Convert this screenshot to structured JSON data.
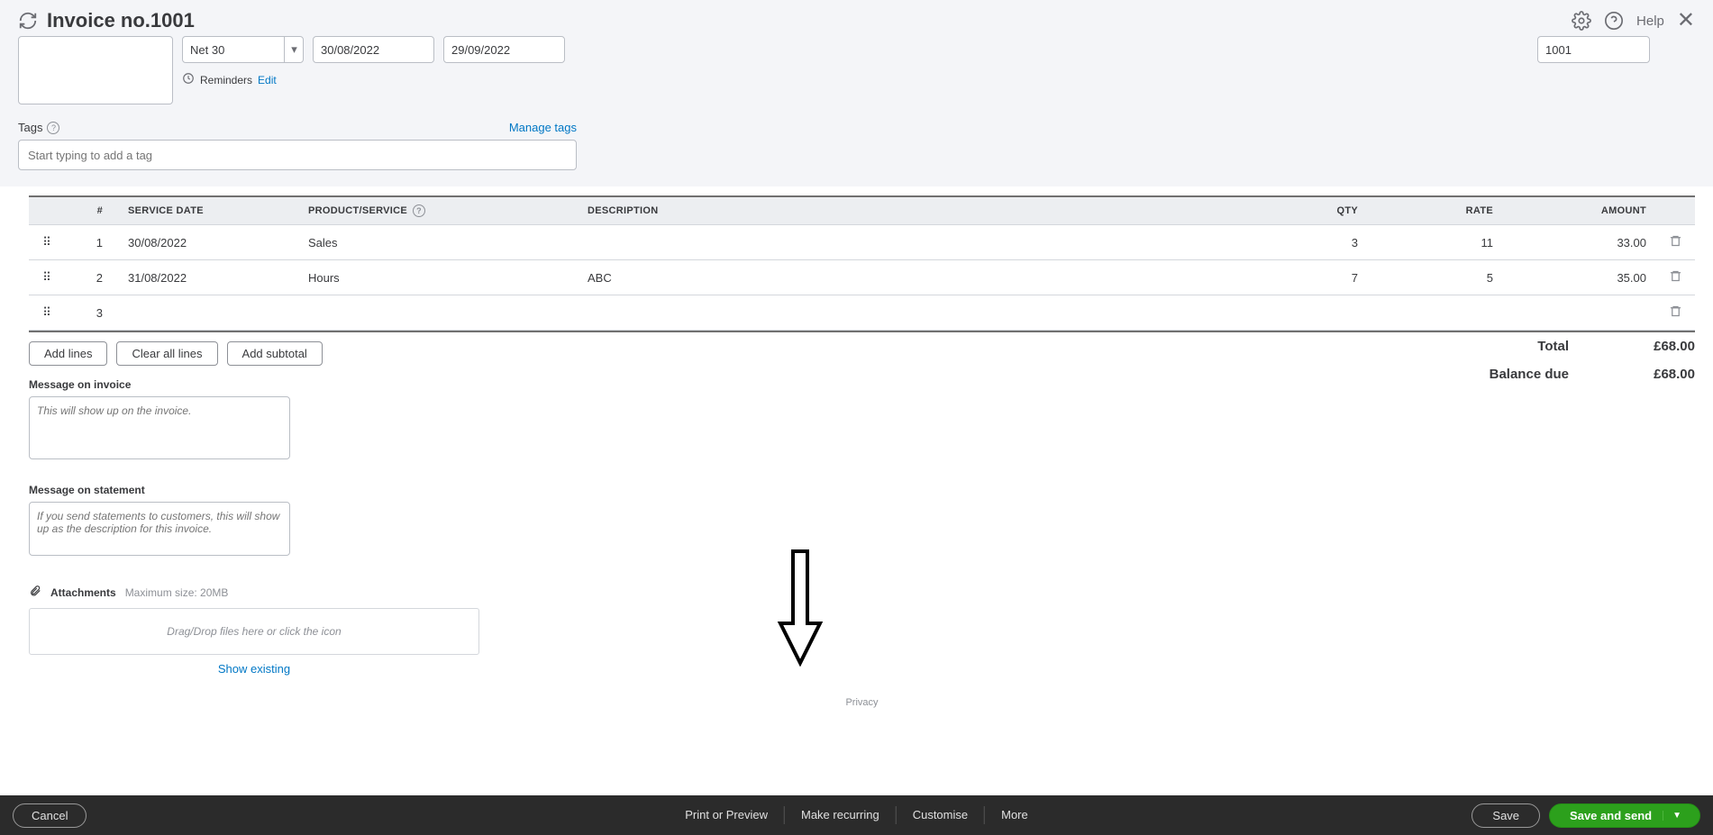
{
  "header": {
    "title": "Invoice no.1001",
    "help_label": "Help"
  },
  "form": {
    "terms_value": "Net 30",
    "invoice_date": "30/08/2022",
    "due_date": "29/09/2022",
    "invoice_no": "1001",
    "reminders_label": "Reminders",
    "reminders_edit": "Edit",
    "tags_label": "Tags",
    "manage_tags": "Manage tags",
    "tags_placeholder": "Start typing to add a tag"
  },
  "table": {
    "headers": {
      "num": "#",
      "service_date": "SERVICE DATE",
      "product": "PRODUCT/SERVICE",
      "description": "DESCRIPTION",
      "qty": "QTY",
      "rate": "RATE",
      "amount": "AMOUNT"
    },
    "rows": [
      {
        "n": "1",
        "date": "30/08/2022",
        "product": "Sales",
        "desc": "",
        "qty": "3",
        "rate": "11",
        "amount": "33.00"
      },
      {
        "n": "2",
        "date": "31/08/2022",
        "product": "Hours",
        "desc": "ABC",
        "qty": "7",
        "rate": "5",
        "amount": "35.00"
      },
      {
        "n": "3",
        "date": "",
        "product": "",
        "desc": "",
        "qty": "",
        "rate": "",
        "amount": ""
      }
    ]
  },
  "buttons": {
    "add_lines": "Add lines",
    "clear_all": "Clear all lines",
    "add_subtotal": "Add subtotal"
  },
  "totals": {
    "total_label": "Total",
    "total_value": "£68.00",
    "balance_label": "Balance due",
    "balance_value": "£68.00"
  },
  "messages": {
    "invoice_label": "Message on invoice",
    "invoice_placeholder": "This will show up on the invoice.",
    "statement_label": "Message on statement",
    "statement_placeholder": "If you send statements to customers, this will show up as the description for this invoice."
  },
  "attachments": {
    "label": "Attachments",
    "hint": "Maximum size: 20MB",
    "drop_text": "Drag/Drop files here or click the icon",
    "show_existing": "Show existing"
  },
  "privacy": "Privacy",
  "footer": {
    "cancel": "Cancel",
    "print_preview": "Print or Preview",
    "make_recurring": "Make recurring",
    "customise": "Customise",
    "more": "More",
    "save": "Save",
    "save_send": "Save and send"
  }
}
